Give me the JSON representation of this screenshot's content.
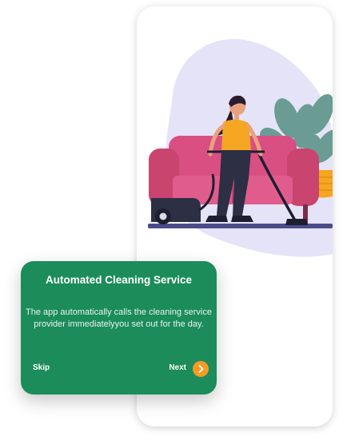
{
  "onboarding": {
    "title": "Automated Cleaning Service",
    "description": "The app automatically calls the cleaning service provider immediatelyyou set out for the day.",
    "skip_label": "Skip",
    "next_label": "Next"
  },
  "icons": {
    "next": "chevron-right-icon",
    "illustration": "woman-vacuuming-illustration"
  },
  "colors": {
    "card_background": "#1b8c5a",
    "accent": "#f59a23",
    "blob": "#e5e3f7",
    "sofa": "#d94f82",
    "floor": "#4a4c8a"
  }
}
